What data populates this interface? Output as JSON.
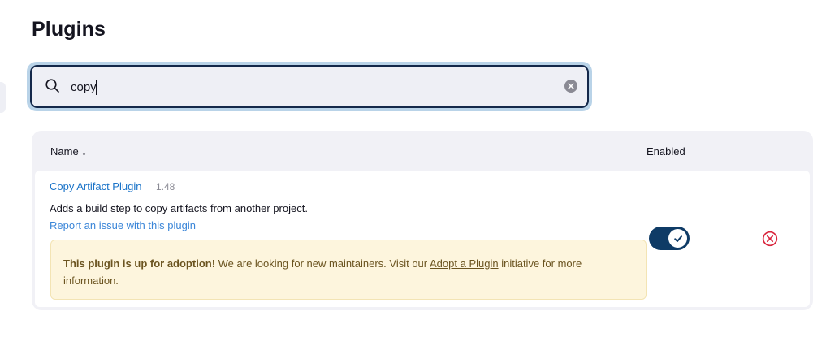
{
  "page": {
    "title": "Plugins"
  },
  "search": {
    "value": "copy",
    "placeholder": ""
  },
  "table": {
    "columns": {
      "name": "Name ↓",
      "enabled": "Enabled"
    },
    "rows": [
      {
        "name": "Copy Artifact Plugin",
        "version": "1.48",
        "description": "Adds a build step to copy artifacts from another project.",
        "report_link": "Report an issue with this plugin",
        "enabled": true,
        "notice": {
          "bold": "This plugin is up for adoption!",
          "text_before_link": " We are looking for new maintainers. Visit our ",
          "link": "Adopt a Plugin",
          "text_after_link": " initiative for more information."
        }
      }
    ]
  },
  "colors": {
    "accent": "#0f3b66",
    "link": "#1a73c8",
    "danger": "#d9263d",
    "notice_bg": "#fdf5dd"
  },
  "icons": {
    "search": "search-icon",
    "clear": "clear-icon",
    "toggle_check": "check-icon",
    "uninstall": "close-circle-icon"
  }
}
